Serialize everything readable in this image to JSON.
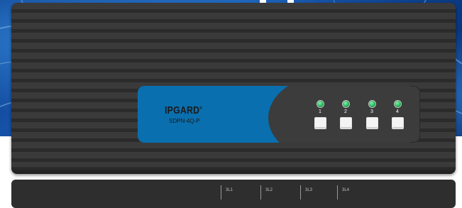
{
  "device": {
    "brand": "IPGARD",
    "trademark": "®",
    "model": "SDPN-4Q-P",
    "ports": [
      {
        "number": "1",
        "led_color": "#1fb25a"
      },
      {
        "number": "2",
        "led_color": "#1fb25a"
      },
      {
        "number": "3",
        "led_color": "#1fb25a"
      },
      {
        "number": "4",
        "led_color": "#1fb25a"
      }
    ],
    "body_color": "#333333",
    "panel_accent_color": "#0a6fae"
  },
  "rear_device": {
    "labels": [
      "3L1",
      "3L2",
      "3L3",
      "3L4"
    ]
  },
  "backdrop": {
    "color": "#1a58ad"
  }
}
